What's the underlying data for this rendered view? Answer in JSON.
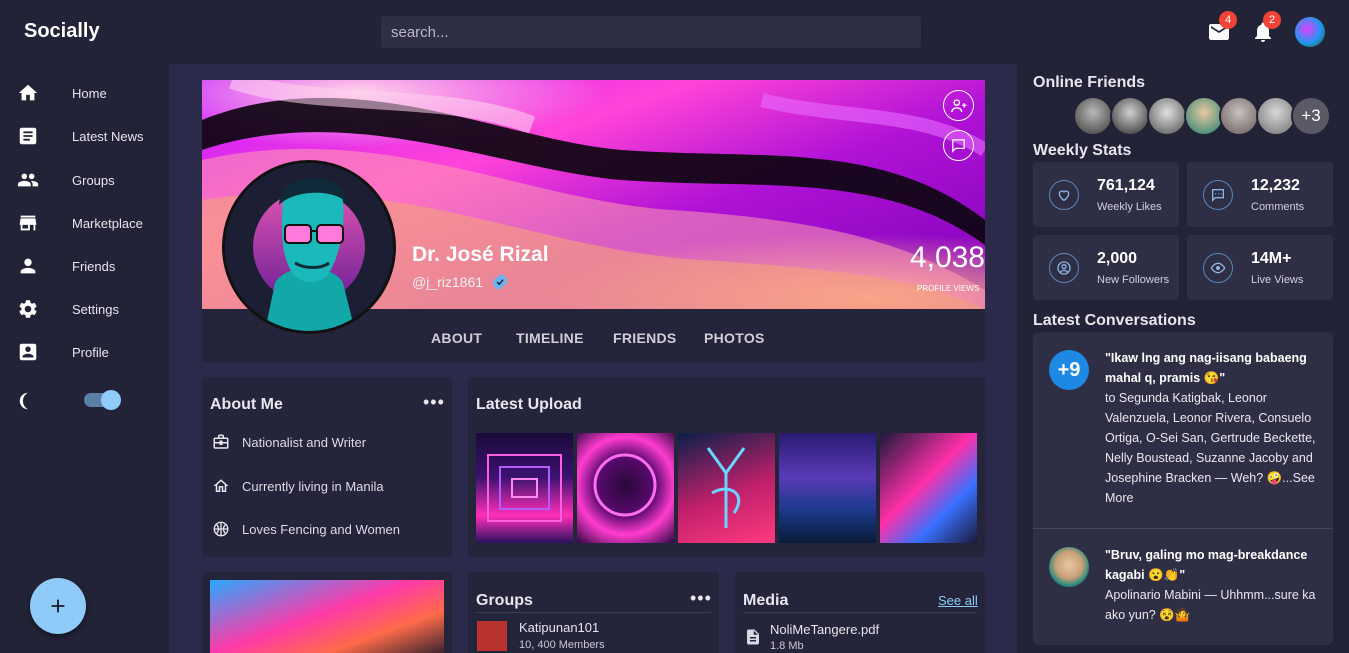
{
  "header": {
    "app_title": "Socially",
    "search_placeholder": "search...",
    "mail_badge": "4",
    "notifications_badge": "2"
  },
  "sidebar": {
    "items": [
      {
        "label": "Home",
        "icon": "home-icon"
      },
      {
        "label": "Latest News",
        "icon": "news-icon"
      },
      {
        "label": "Groups",
        "icon": "groups-icon"
      },
      {
        "label": "Marketplace",
        "icon": "store-icon"
      },
      {
        "label": "Friends",
        "icon": "person-icon"
      },
      {
        "label": "Settings",
        "icon": "gear-icon"
      },
      {
        "label": "Profile",
        "icon": "profile-icon"
      }
    ],
    "dark_mode_on": true
  },
  "profile": {
    "name": "Dr. José Rizal",
    "handle": "@j_riz1861",
    "views_count": "4,038",
    "views_label": "PROFILE VIEWS",
    "tabs": [
      "ABOUT",
      "TIMELINE",
      "FRIENDS",
      "PHOTOS"
    ]
  },
  "about": {
    "title": "About Me",
    "items": [
      {
        "icon": "briefcase-icon",
        "text": "Nationalist and Writer"
      },
      {
        "icon": "house-icon",
        "text": "Currently living in Manila"
      },
      {
        "icon": "basketball-icon",
        "text": "Loves Fencing and Women"
      }
    ]
  },
  "latest_upload": {
    "title": "Latest Upload"
  },
  "groups": {
    "title": "Groups",
    "items": [
      {
        "name": "Katipunan101",
        "members": "10, 400 Members"
      }
    ]
  },
  "media": {
    "title": "Media",
    "see_all": "See all",
    "items": [
      {
        "name": "NoliMeTangere.pdf",
        "size": "1.8 Mb"
      }
    ]
  },
  "online_friends": {
    "title": "Online Friends",
    "more": "+3"
  },
  "weekly_stats": {
    "title": "Weekly Stats",
    "items": [
      {
        "value": "761,124",
        "label": "Weekly Likes",
        "icon": "heart-icon"
      },
      {
        "value": "12,232",
        "label": "Comments",
        "icon": "comment-icon"
      },
      {
        "value": "2,000",
        "label": "New Followers",
        "icon": "follower-icon"
      },
      {
        "value": "14M+",
        "label": "Live Views",
        "icon": "eye-icon"
      }
    ]
  },
  "conversations": {
    "title": "Latest Conversations",
    "items": [
      {
        "badge": "+9",
        "quote": "\"Ikaw lng ang nag-iisang babaeng mahal q, pramis 😘\"",
        "body": "to Segunda Katigbak, Leonor Valenzuela, Leonor Rivera, Consuelo Ortiga, O-Sei San, Gertrude Beckette, Nelly Boustead, Suzanne Jacoby and Josephine Bracken — Weh? 🤪...See More"
      },
      {
        "quote": "\"Bruv, galing mo mag-breakdance kagabi 😮👏\"",
        "body": "Apolinario Mabini — Uhhmm...sure ka ako yun? 😵🤷"
      }
    ]
  },
  "colors": {
    "background": "#2b2a4a",
    "panel": "#222336",
    "card": "#24253a",
    "accent": "#90caf9",
    "badge": "#f44336"
  }
}
